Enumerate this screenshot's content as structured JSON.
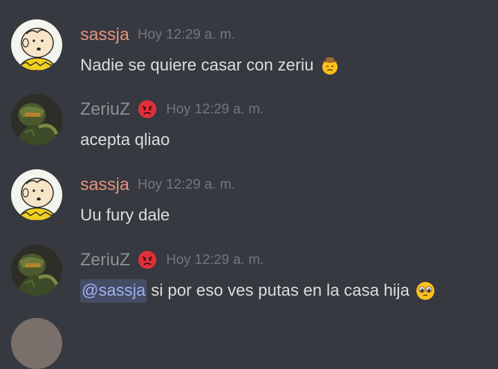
{
  "messages": [
    {
      "author": "sassja",
      "author_color": "#e8927c",
      "avatar_icon": "charlie-brown-avatar",
      "timestamp": "Hoy 12:29 a. m.",
      "text": "Nadie se quiere casar con zeriu",
      "emoji": "cowboy-unamused-emoji"
    },
    {
      "author": "ZeriuZ",
      "author_color": "#8e9297",
      "avatar_icon": "doom-slayer-avatar",
      "badge_icon": "angry-face-emoji",
      "timestamp": "Hoy 12:29 a. m.",
      "text": "acepta qliao"
    },
    {
      "author": "sassja",
      "author_color": "#e8927c",
      "avatar_icon": "charlie-brown-avatar",
      "timestamp": "Hoy 12:29 a. m.",
      "text": "Uu fury dale"
    },
    {
      "author": "ZeriuZ",
      "author_color": "#8e9297",
      "avatar_icon": "doom-slayer-avatar",
      "badge_icon": "angry-face-emoji",
      "timestamp": "Hoy 12:29 a. m.",
      "mention": "@sassja",
      "text": "si por eso ves putas en la casa hija",
      "emoji": "pleading-face-emoji"
    }
  ],
  "colors": {
    "background": "#36393f",
    "text": "#dcddde",
    "timestamp": "#72767d",
    "mention_bg": "rgba(114,137,218,0.25)",
    "mention_text": "#9fb1ec"
  }
}
